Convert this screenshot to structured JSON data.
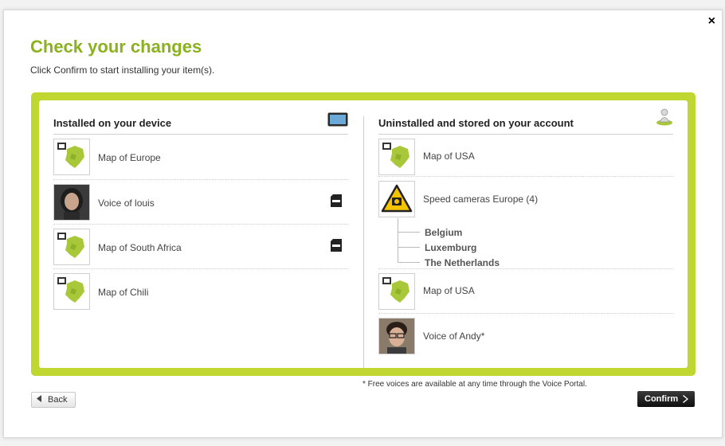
{
  "dialog": {
    "title": "Check your changes",
    "subtitle": "Click Confirm to start installing your item(s).",
    "close_label": "×"
  },
  "installed": {
    "heading": "Installed on your device",
    "heading_icon": "device-icon",
    "items": [
      {
        "label": "Map of Europe",
        "icon": "map-icon",
        "on_sd_card": false
      },
      {
        "label": "Voice of louis",
        "icon": "voice-portrait",
        "on_sd_card": true
      },
      {
        "label": "Map of South Africa",
        "icon": "map-icon",
        "on_sd_card": true
      },
      {
        "label": "Map of Chili",
        "icon": "map-icon",
        "on_sd_card": false
      }
    ]
  },
  "uninstalled": {
    "heading": "Uninstalled and stored on your account",
    "heading_icon": "account-icon",
    "items": [
      {
        "label": "Map of USA",
        "icon": "map-icon"
      },
      {
        "label": "Speed cameras Europe (4)",
        "icon": "speed-camera-icon",
        "children": [
          "Belgium",
          "Luxemburg",
          "The Netherlands"
        ]
      },
      {
        "label": "Map of USA",
        "icon": "map-icon"
      },
      {
        "label": "Voice of Andy*",
        "icon": "voice-portrait"
      }
    ]
  },
  "footnote": "* Free voices are available at any time through the Voice Portal.",
  "buttons": {
    "back": "Back",
    "confirm": "Confirm"
  },
  "colors": {
    "accent_green": "#8bb21e",
    "panel_border": "#bfd730",
    "speed_camera_yellow": "#f5c400"
  }
}
